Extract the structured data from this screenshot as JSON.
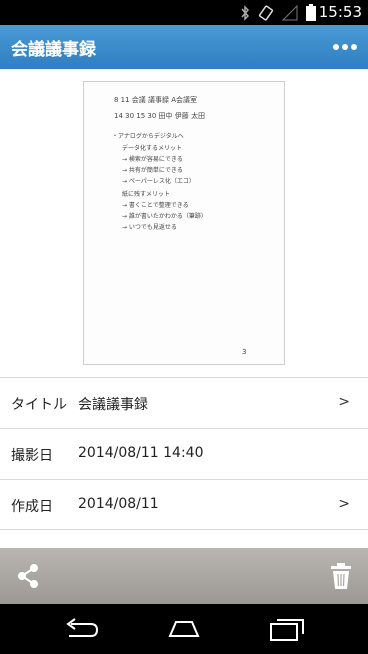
{
  "status_bar": {
    "time": "15:53",
    "icons": [
      "bluetooth-icon",
      "rotation-icon",
      "signal-icon",
      "battery-icon"
    ]
  },
  "app_bar": {
    "title": "会議議事録",
    "overflow_icon": "more-dots-icon"
  },
  "preview": {
    "header_lines": [
      "8  11   会議 議事録        A会議室",
      "14 30 15 30      田中 伊藤 太田"
    ],
    "note_lines": [
      "・アナログからデジタルへ",
      "データ化するメリット",
      "→ 検索が容易にできる",
      "→ 共有が簡単にできる",
      "→ ペーパーレス化（エコ）",
      "紙に残すメリット",
      "→ 書くことで整理できる",
      "→ 誰が書いたかわかる（筆跡）",
      "→ いつでも見返せる"
    ],
    "page_number": "3"
  },
  "details": {
    "title_label": "タイトル",
    "title_value": "会議議事録",
    "shot_label": "撮影日",
    "shot_value": "2014/08/11 14:40",
    "created_label": "作成日",
    "created_value": "2014/08/11",
    "chevron": ">"
  },
  "action_bar": {
    "share_icon": "share-icon",
    "delete_icon": "trash-icon"
  },
  "nav_bar": {
    "icons": [
      "back-icon",
      "home-icon",
      "recents-icon"
    ]
  },
  "colors": {
    "app_bar": "#3a8bcb",
    "action_bar": "#aaa7a2"
  }
}
